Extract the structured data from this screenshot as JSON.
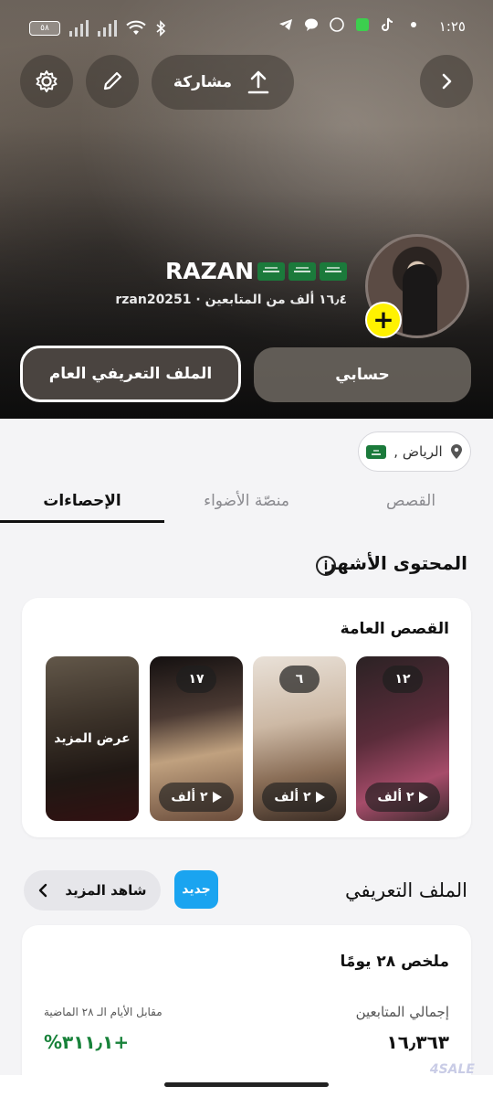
{
  "status_bar": {
    "time": "١:٢٥",
    "battery": "٥٨"
  },
  "header": {
    "share_label": "مشاركة"
  },
  "profile": {
    "display_name": "RAZAN",
    "subline": "rzan20251 · ١٦٫٤ ألف من المتابعين",
    "public_profile_button": "الملف التعريفي العام",
    "account_button": "حسابي",
    "location": "الرياض ,"
  },
  "tabs": [
    {
      "label": "القصص",
      "active": false
    },
    {
      "label": "منصّة الأضواء",
      "active": false
    },
    {
      "label": "الإحصاءات",
      "active": true
    }
  ],
  "top_content": {
    "title": "المحتوى الأشهر",
    "card_heading": "القصص العامة",
    "stories": [
      {
        "count": "١٢",
        "views": "٢ ألف",
        "colors": [
          "#5a2c3a",
          "#a64c6a"
        ]
      },
      {
        "count": "٦",
        "views": "٢ ألف",
        "colors": [
          "#b69e88",
          "#e9e1d8"
        ]
      },
      {
        "count": "١٧",
        "views": "٢ ألف",
        "colors": [
          "#4b3a33",
          "#c0a17f"
        ]
      }
    ],
    "see_more_tile": "عرض المزيد"
  },
  "profile_section": {
    "title": "الملف التعريفي",
    "new_badge": "جديد",
    "see_more": "شاهد المزيد",
    "summary_title": "ملخص ٢٨ يومًا",
    "followers_label": "إجمالي المتابعين",
    "followers_value": "١٦٫٣٦٣",
    "compare_label": "مقابل الأيام الـ ٢٨ الماضية",
    "change_value": "+٣١١٫١%",
    "change_color": "#18823a"
  },
  "watermark": "4SALE"
}
